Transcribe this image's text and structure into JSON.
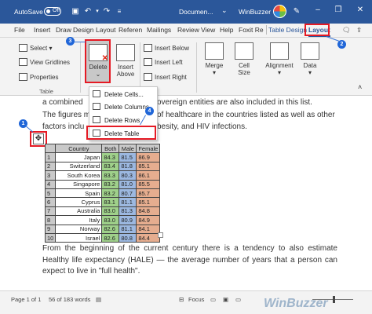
{
  "titlebar": {
    "autosave_label": "AutoSave",
    "autosave_state": "Off",
    "doc_title": "Documen...",
    "user_name": "WinBuzzer",
    "minimize": "–",
    "restore": "❐",
    "close": "✕"
  },
  "tabs": [
    {
      "label": "File"
    },
    {
      "label": "Insert"
    },
    {
      "label": "Draw"
    },
    {
      "label": "Design"
    },
    {
      "label": "Layout"
    },
    {
      "label": "Referen"
    },
    {
      "label": "Mailings"
    },
    {
      "label": "Review"
    },
    {
      "label": "View"
    },
    {
      "label": "Help"
    },
    {
      "label": "Foxit Re"
    },
    {
      "label": "Table Design"
    },
    {
      "label": "Layout"
    }
  ],
  "ribbon": {
    "select": "Select",
    "view_gridlines": "View Gridlines",
    "properties": "Properties",
    "group_table": "Table",
    "delete": "Delete",
    "insert_above_1": "Insert",
    "insert_above_2": "Above",
    "insert_below": "Insert Below",
    "insert_left": "Insert Left",
    "insert_right": "Insert Right",
    "merge": "Merge",
    "cell_size_1": "Cell",
    "cell_size_2": "Size",
    "alignment": "Alignment",
    "data": "Data"
  },
  "delete_menu": {
    "items": [
      "Delete Cells...",
      "Delete Columns",
      "Delete Rows",
      "Delete Table"
    ]
  },
  "document": {
    "line1_a": "a combined",
    "line1_b": "overeign entities are also included in this list.",
    "line2_a": "The figures m",
    "line2_b": "of healthcare in the countries listed as well as other",
    "line3_a": "factors inclu",
    "line3_b": "besity, and HIV infections.",
    "after_table": "From the beginning of the current century there is a tendency to also estimate Healthy life expectancy (HALE) — the average number of years that a person can expect to live in \"full health\"."
  },
  "table": {
    "headers": [
      "",
      "Country",
      "Both",
      "Male",
      "Female"
    ],
    "rows": [
      [
        "1",
        "Japan",
        "84.3",
        "81.5",
        "86.9"
      ],
      [
        "2",
        "Switzerland",
        "83.4",
        "81.8",
        "85.1"
      ],
      [
        "3",
        "South Korea",
        "83.3",
        "80.3",
        "86.1"
      ],
      [
        "4",
        "Singapore",
        "83.2",
        "81.0",
        "85.5"
      ],
      [
        "5",
        "Spain",
        "83.2",
        "80.7",
        "85.7"
      ],
      [
        "6",
        "Cyprus",
        "83.1",
        "81.1",
        "85.1"
      ],
      [
        "7",
        "Australia",
        "83.0",
        "81.3",
        "84.8"
      ],
      [
        "8",
        "Italy",
        "83.0",
        "80.9",
        "84.9"
      ],
      [
        "9",
        "Norway",
        "82.6",
        "81.1",
        "84.1"
      ],
      [
        "10",
        "Israel",
        "82.6",
        "80.8",
        "84.4"
      ]
    ],
    "colors": {
      "both": "#9fd08a",
      "male": "#9cb8e0",
      "female": "#e6ad8f",
      "header": "#c9c9c9",
      "country": "#ffffff"
    }
  },
  "callouts": [
    "1",
    "2",
    "3",
    "4"
  ],
  "status": {
    "page": "Page 1 of 1",
    "words": "56 of 183 words",
    "focus": "Focus"
  },
  "watermark": "WinBuzzer",
  "colors": {
    "accent": "#2b579a",
    "highlight_red": "#e51a24",
    "callout_blue": "#2066d8"
  }
}
